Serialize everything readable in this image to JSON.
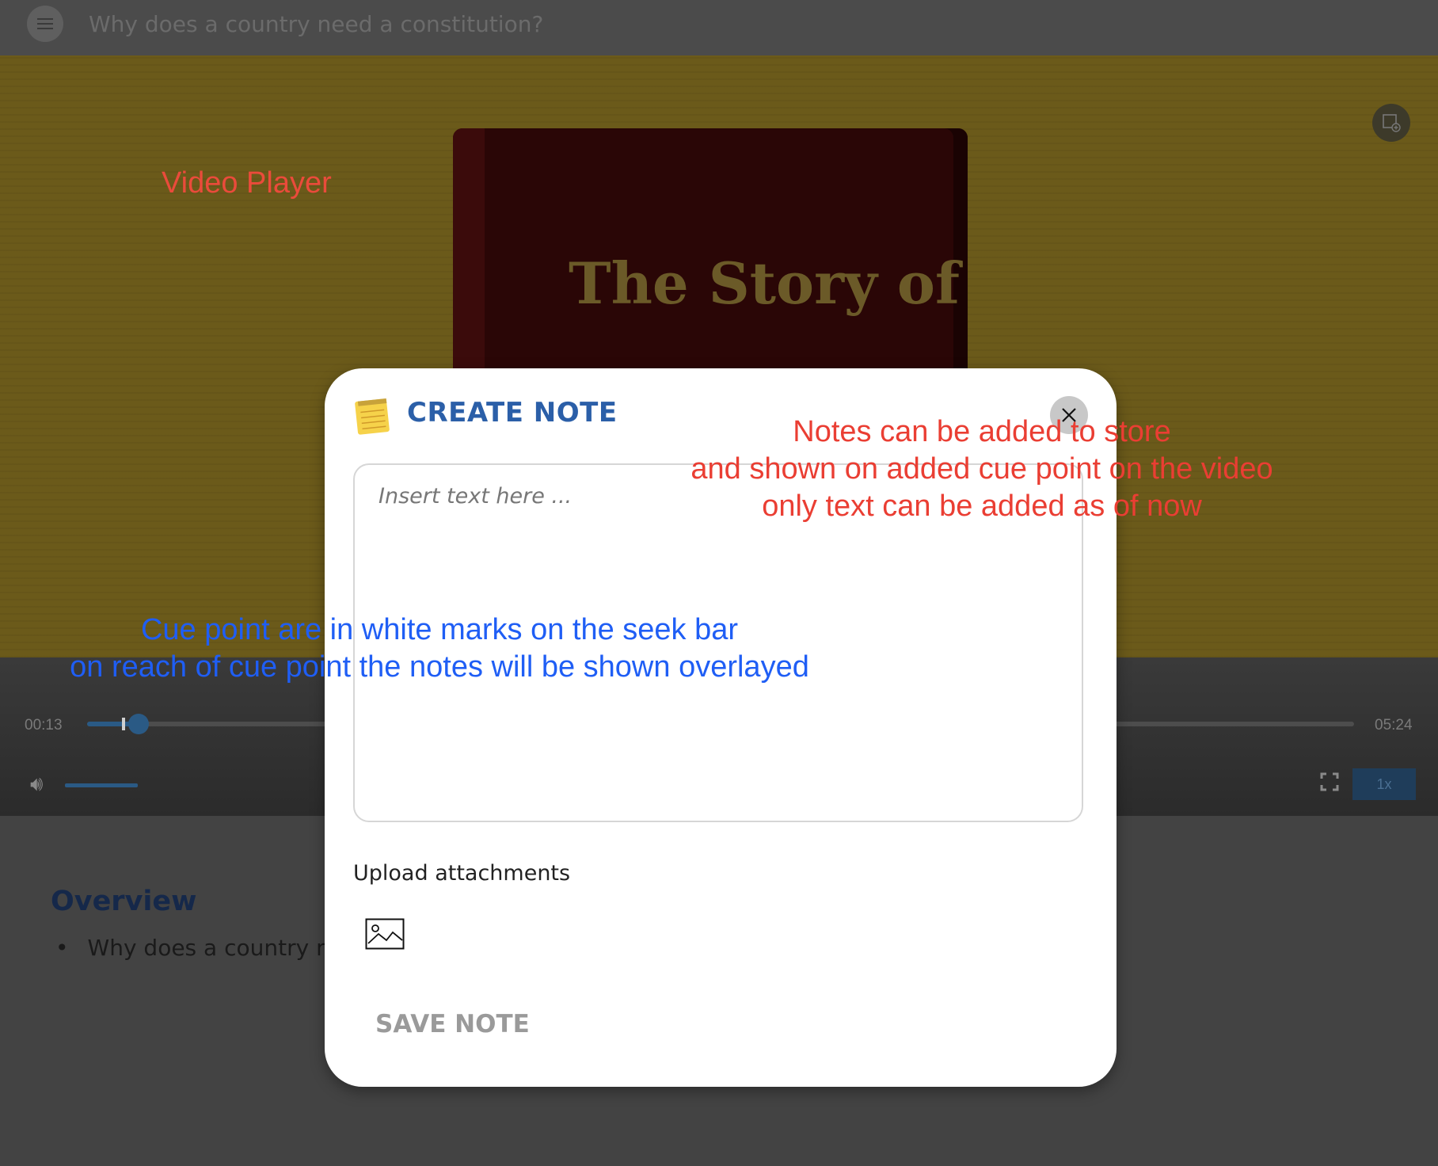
{
  "header": {
    "menu_icon": "hamburger-menu-icon",
    "title": "Why does a country need a constitution?"
  },
  "video": {
    "frame_text": "The Story of",
    "current_time": "00:13",
    "duration": "05:24",
    "progress_fraction": 0.04,
    "volume_fraction": 1.0,
    "speed_label": "1x",
    "pip_icon": "add-note-overlay-icon",
    "volume_icon": "volume-icon",
    "fullscreen_icon": "fullscreen-icon"
  },
  "overview": {
    "title": "Overview",
    "items": [
      "Why does a country nee"
    ]
  },
  "modal": {
    "title": "CREATE NOTE",
    "title_icon": "notepad-icon",
    "close_icon": "close-icon",
    "textarea_placeholder": "Insert text here ...",
    "textarea_value": "",
    "upload_label": "Upload attachments",
    "upload_icon": "image-icon",
    "save_label": "SAVE NOTE"
  },
  "annotations": {
    "video_player": "Video Player",
    "notes": [
      "Notes can be added to store",
      "and shown on added cue point on the video",
      "only text can be added as of now"
    ],
    "cue_points": [
      "Cue point are in white marks on the seek bar",
      "on reach of cue point the notes will be shown overlayed"
    ]
  },
  "colors": {
    "annotation_red": "#ea3e33",
    "annotation_blue": "#1f5ef5",
    "modal_title_blue": "#2b5fa8",
    "player_accent": "#2a5a85"
  }
}
